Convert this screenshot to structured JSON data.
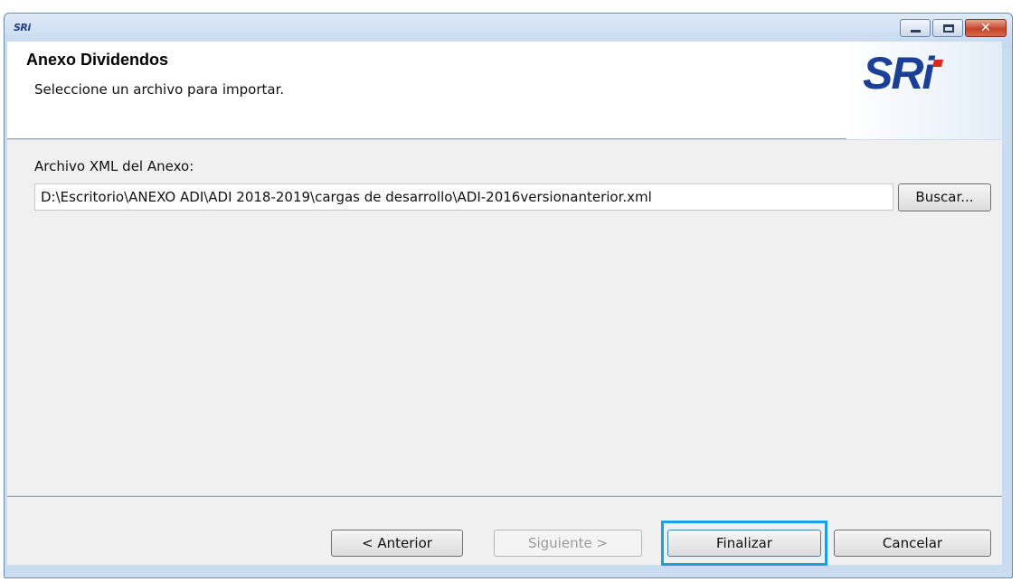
{
  "window": {
    "app_icon_text": "SRi",
    "controls": [
      "minimize-icon",
      "maximize-icon",
      "close-icon"
    ],
    "close_glyph": "✕"
  },
  "header": {
    "title": "Anexo Dividendos",
    "subtitle": "Seleccione un archivo para importar.",
    "logo_text": "SRi",
    "logo_color": "#1b3f96",
    "logo_accent_color": "#e1251b"
  },
  "form": {
    "file_label": "Archivo XML del Anexo:",
    "file_path": "D:\\Escritorio\\ANEXO ADI\\ADI 2018-2019\\cargas de desarrollo\\ADI-2016versionanterior.xml",
    "browse_label": "Buscar..."
  },
  "footer": {
    "back_label": "< Anterior",
    "next_label": "Siguiente >",
    "finish_label": "Finalizar",
    "cancel_label": "Cancelar",
    "focused_button": "Finalizar",
    "focus_color": "#1fa0de",
    "next_enabled": false
  }
}
